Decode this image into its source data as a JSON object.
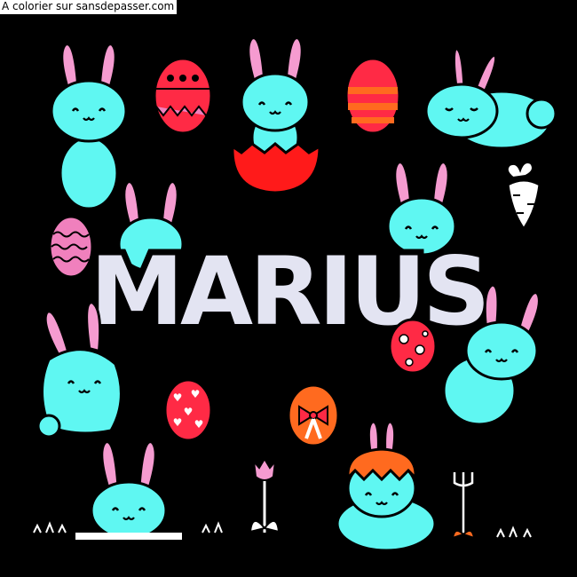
{
  "credit_text": "A colorier sur sansdepasser.com",
  "name": "MARIUS",
  "colors": {
    "background": "#000000",
    "bunny": "#5ff7f2",
    "ears": "#f59bd0",
    "name_fill": "#e3e4f2",
    "outline": "#000000",
    "egg_red": "#ff2a45",
    "egg_orange": "#ff6a1f",
    "egg_pink": "#f080bd",
    "shell_red": "#ff1a1a",
    "hair_orange": "#ff6a1f",
    "carrot": "#ffffff"
  },
  "icons": [
    "bunny-icon",
    "easter-egg-icon",
    "bunny-in-eggshell-icon",
    "sleeping-bunny-icon",
    "carrot-icon",
    "tulip-icon",
    "grass-icon"
  ]
}
